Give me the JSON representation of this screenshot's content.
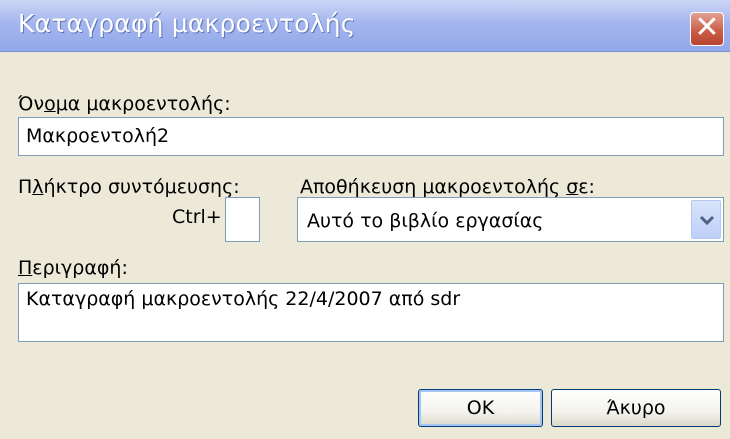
{
  "dialog": {
    "title": "Καταγραφή μακροεντολής",
    "close_symbol": "✕"
  },
  "macro_name": {
    "label_pre": "Όν",
    "label_accel": "ο",
    "label_post": "μα μακροεντολής:",
    "value": "Μακροεντολή2"
  },
  "shortcut": {
    "label_pre": "Π",
    "label_accel": "λ",
    "label_post": "ήκτρο συντόμευσης:",
    "prefix": "Ctrl+",
    "value": ""
  },
  "store_in": {
    "label_pre": "Αποθήκευση μακροεντολής ",
    "label_accel": "σ",
    "label_post": "ε:",
    "selected": "Αυτό το βιβλίο εργασίας"
  },
  "description": {
    "label_accel": "Π",
    "label_post": "εριγραφή:",
    "value": "Καταγραφή μακροεντολής 22/4/2007 από sdr"
  },
  "buttons": {
    "ok": "OK",
    "cancel": "Άκυρο"
  },
  "icons": {
    "close": "close-icon",
    "dropdown": "chevron-down-icon"
  },
  "colors": {
    "titlebar": "#a4b6ee",
    "close": "#cc5e4a",
    "face": "#ece9d8",
    "border": "#7f9db9"
  }
}
